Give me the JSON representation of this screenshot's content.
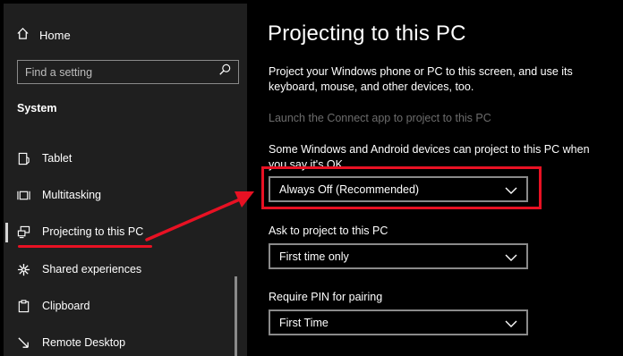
{
  "sidebar": {
    "home_label": "Home",
    "search_placeholder": "Find a setting",
    "section_title": "System",
    "items": [
      {
        "label": "Tablet",
        "icon": "tablet-icon"
      },
      {
        "label": "Multitasking",
        "icon": "multitasking-icon"
      },
      {
        "label": "Projecting to this PC",
        "icon": "projecting-icon",
        "selected": true
      },
      {
        "label": "Shared experiences",
        "icon": "shared-experiences-icon"
      },
      {
        "label": "Clipboard",
        "icon": "clipboard-icon"
      },
      {
        "label": "Remote Desktop",
        "icon": "remote-desktop-icon"
      }
    ]
  },
  "main": {
    "title": "Projecting to this PC",
    "description": "Project your Windows phone or PC to this screen, and use its keyboard, mouse, and other devices, too.",
    "connect_link": "Launch the Connect app to project to this PC",
    "permission_label": "Some Windows and Android devices can project to this PC when you say it's OK",
    "permission_value": "Always Off (Recommended)",
    "ask_label": "Ask to project to this PC",
    "ask_value": "First time only",
    "pin_label": "Require PIN for pairing",
    "pin_value": "First Time"
  },
  "colors": {
    "annotation": "#e81123",
    "sidebar_bg": "#1f1f1f",
    "main_bg": "#000000"
  }
}
